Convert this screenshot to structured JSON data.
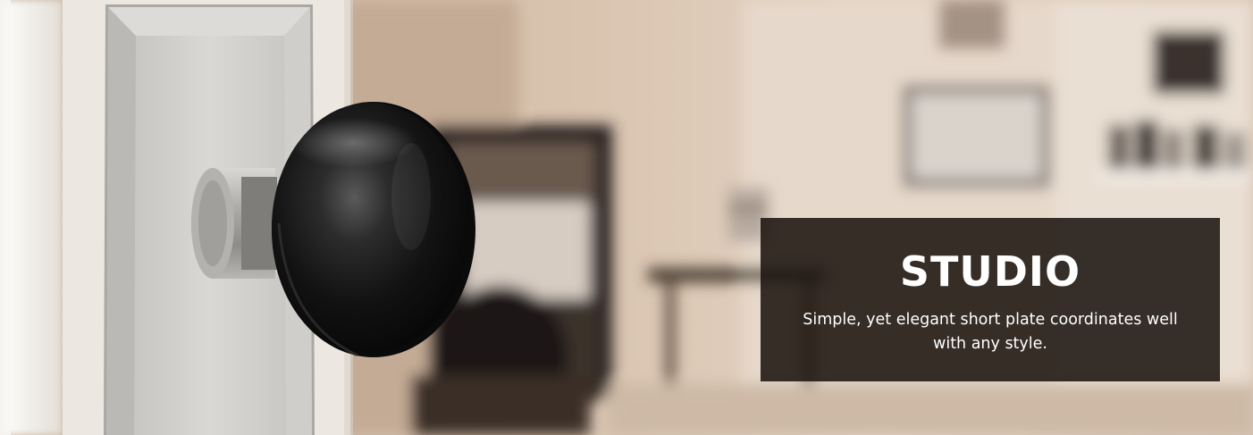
{
  "banner": {
    "title": "STUDIO",
    "description": "Simple, yet elegant short plate coordinates well with any style."
  },
  "image": {
    "subject": "door-knob-icon",
    "colors": {
      "knob": "#111111",
      "plate": "#c9c8c4",
      "wall": "#e7dccf",
      "caption_bg": "#18100c"
    }
  }
}
